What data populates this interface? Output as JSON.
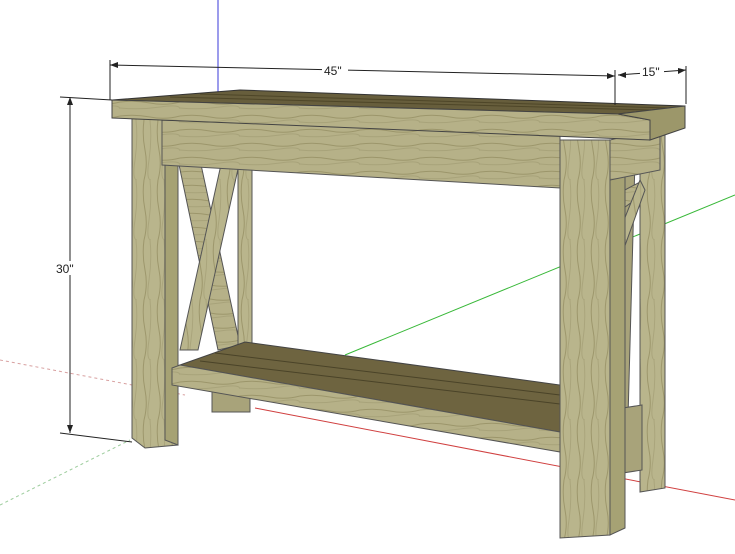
{
  "dimensions": {
    "width_label": "45\"",
    "depth_label": "15\"",
    "height_label": "30\""
  },
  "colors": {
    "wood_light": "#bcb88f",
    "wood_mid": "#a6a274",
    "wood_dark": "#867f52",
    "top_surface": "#675e3c",
    "shelf_surface": "#6e6440",
    "axis_red": "#d04040",
    "axis_green": "#38b838",
    "axis_blue": "#3a3ad8"
  }
}
